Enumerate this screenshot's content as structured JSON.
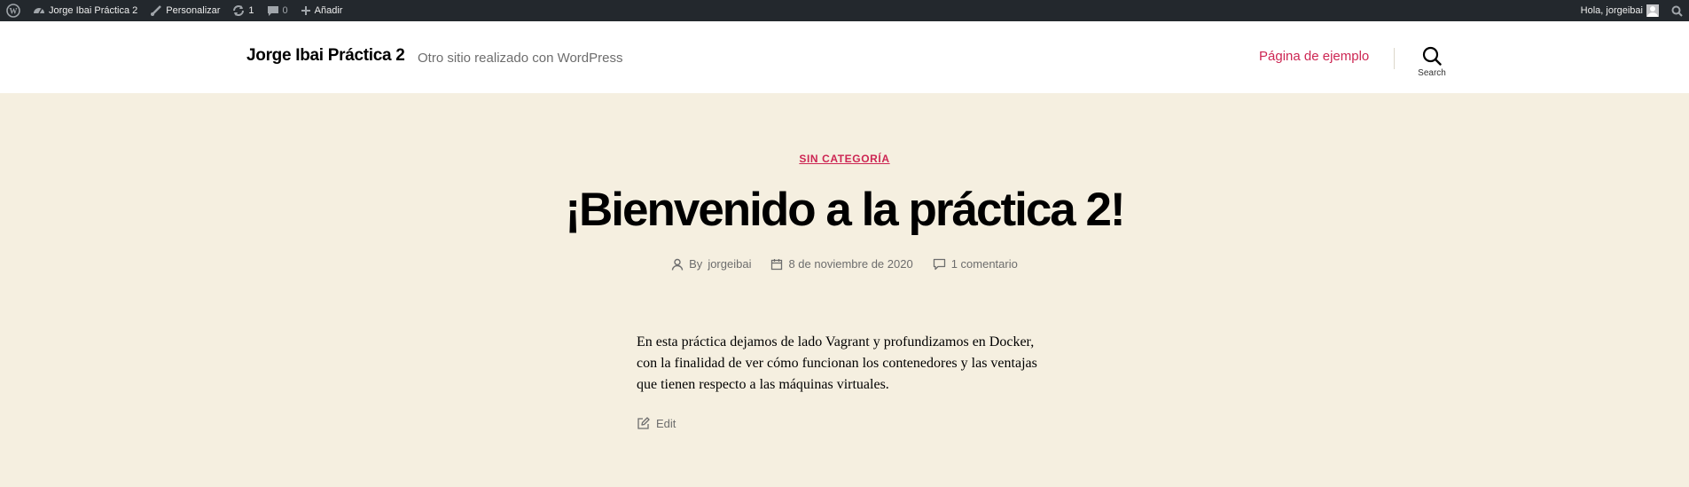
{
  "adminbar": {
    "site_name": "Jorge Ibai Práctica 2",
    "customize": "Personalizar",
    "updates_count": "1",
    "comments_count": "0",
    "add_new": "Añadir",
    "greeting": "Hola, jorgeibai"
  },
  "header": {
    "site_title": "Jorge Ibai Práctica 2",
    "site_description": "Otro sitio realizado con WordPress",
    "menu_item": "Página de ejemplo",
    "search_label": "Search"
  },
  "post": {
    "category": "SIN CATEGORÍA",
    "title": "¡Bienvenido a la práctica 2!",
    "author_prefix": "By ",
    "author": "jorgeibai",
    "date": "8 de noviembre de 2020",
    "comments": "1 comentario",
    "content": "En esta práctica dejamos de lado Vagrant y profundizamos en Docker, con la finalidad de ver cómo funcionan los contenedores y las ventajas que tienen respecto a las máquinas virtuales.",
    "edit_label": "Edit"
  },
  "colors": {
    "accent": "#cd2653",
    "background": "#f5efe0",
    "adminbar": "#23282d"
  }
}
